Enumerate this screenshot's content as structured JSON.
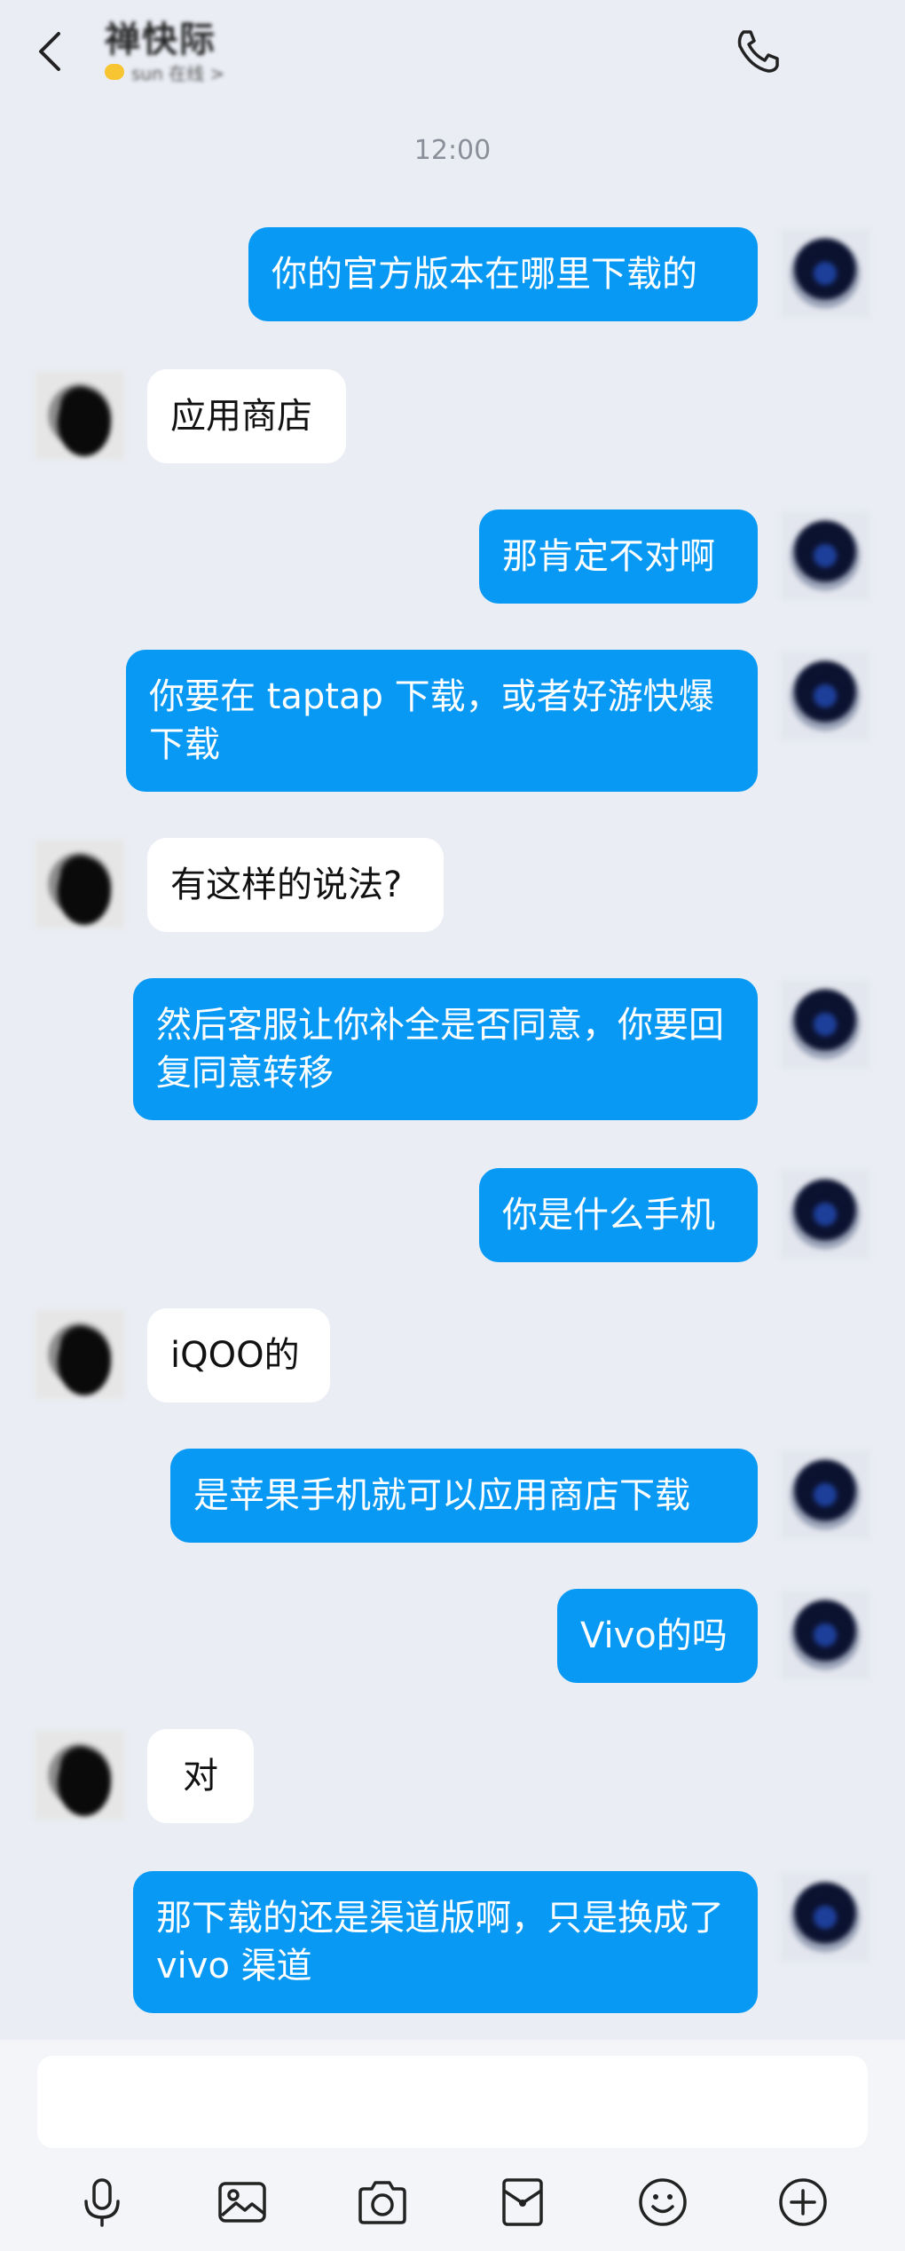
{
  "header": {
    "contact_name": "禅快际",
    "status_text": "sun 在线 >",
    "back_icon": "chevron-left-icon",
    "call_icon": "phone-icon"
  },
  "time_label": "12:00",
  "messages": [
    {
      "side": "me",
      "text": "你的官方版本在哪里下载的"
    },
    {
      "side": "them",
      "text": "应用商店"
    },
    {
      "side": "me",
      "text": "那肯定不对啊"
    },
    {
      "side": "me",
      "text": "你要在 taptap 下载，或者好游快爆下载"
    },
    {
      "side": "them",
      "text": "有这样的说法?"
    },
    {
      "side": "me",
      "text": "然后客服让你补全是否同意，你要回复同意转移"
    },
    {
      "side": "me",
      "text": "你是什么手机"
    },
    {
      "side": "them",
      "text": "iQOO的"
    },
    {
      "side": "me",
      "text": "是苹果手机就可以应用商店下载"
    },
    {
      "side": "me",
      "text": "Vivo的吗"
    },
    {
      "side": "them",
      "text": "对"
    },
    {
      "side": "me",
      "text": "那下载的还是渠道版啊，只是换成了 vivo 渠道"
    }
  ],
  "input": {
    "value": "",
    "placeholder": ""
  },
  "toolbar": [
    "microphone-icon",
    "image-icon",
    "camera-icon",
    "red-packet-icon",
    "emoji-icon",
    "plus-icon"
  ],
  "colors": {
    "my_bubble": "#0899f5",
    "their_bubble": "#ffffff",
    "background": "#eaedf4"
  }
}
